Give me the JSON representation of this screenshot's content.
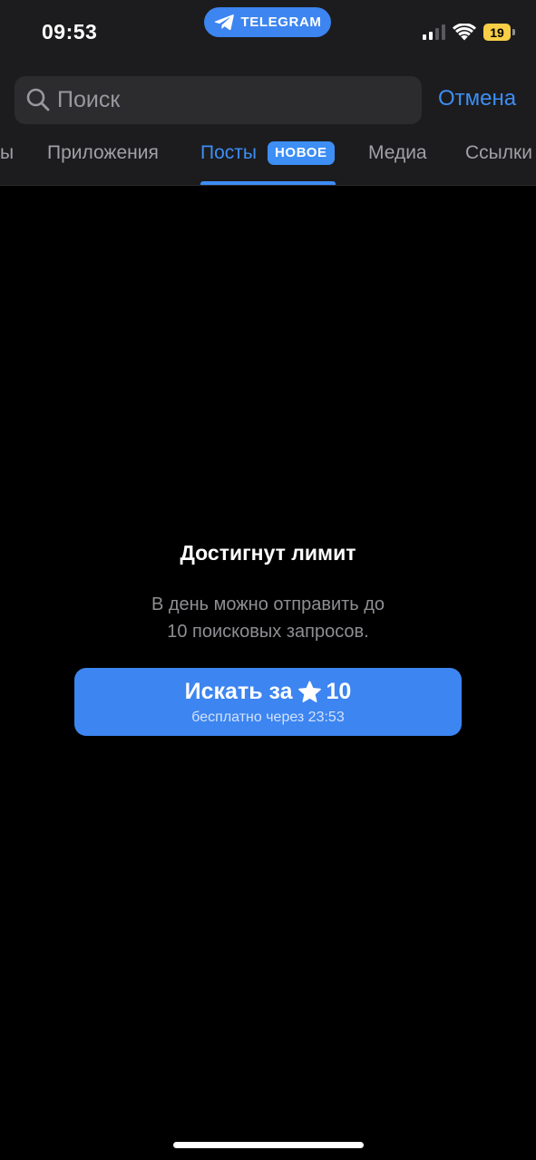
{
  "status_bar": {
    "time": "09:53",
    "app_pill": "TELEGRAM",
    "battery": "19"
  },
  "search": {
    "placeholder": "Поиск",
    "value": "",
    "cancel_label": "Отмена"
  },
  "tabs": [
    {
      "label": "ы",
      "active": false
    },
    {
      "label": "Приложения",
      "active": false
    },
    {
      "label": "Посты",
      "active": true,
      "badge": "НОВОЕ"
    },
    {
      "label": "Медиа",
      "active": false
    },
    {
      "label": "Ссылки",
      "active": false
    }
  ],
  "limit": {
    "title": "Достигнут лимит",
    "description_line1": "В день можно отправить до",
    "description_line2": "10 поисковых запросов.",
    "button_prefix": "Искать за",
    "button_amount": "10",
    "button_subtitle": "бесплатно через 23:53"
  },
  "colors": {
    "accent": "#3d8ef5",
    "button": "#3d85f0",
    "header_bg": "#1c1c1e",
    "battery": "#f7ce46"
  },
  "icons": {
    "search": "magnifier-icon",
    "star": "star-icon",
    "telegram": "paper-plane-icon"
  }
}
